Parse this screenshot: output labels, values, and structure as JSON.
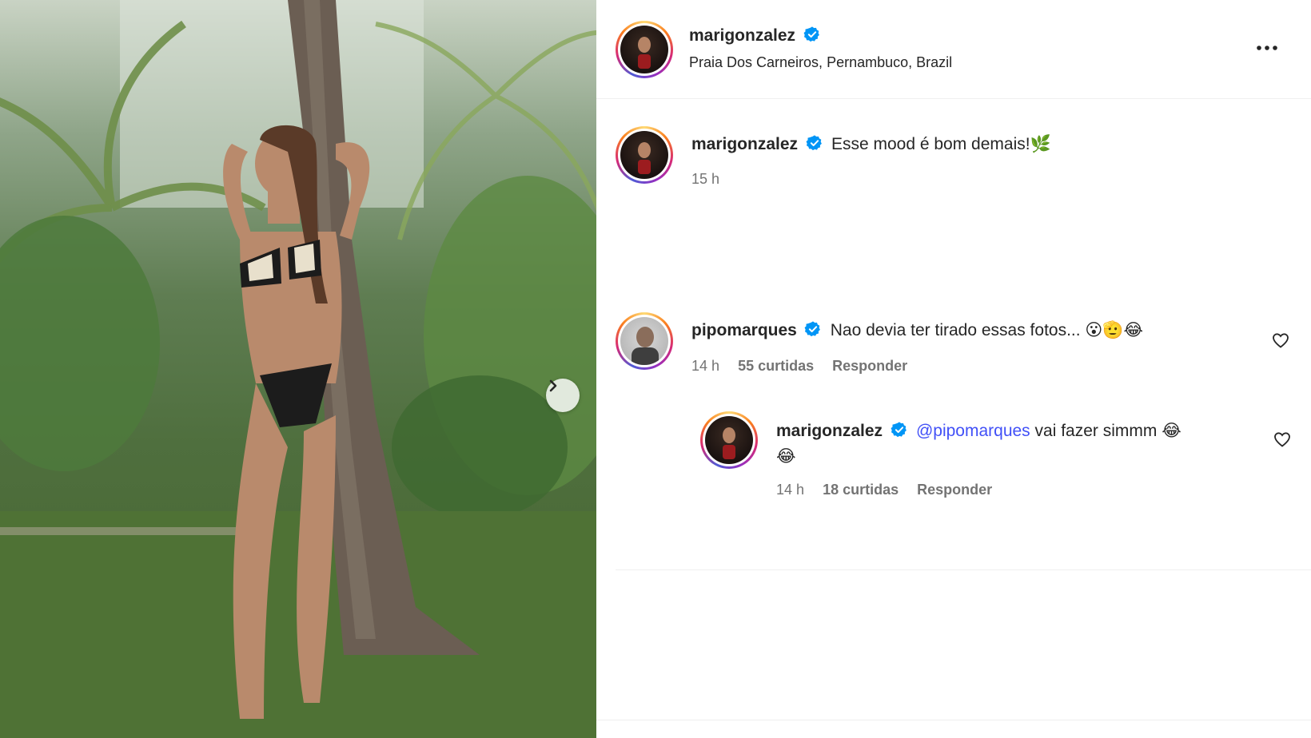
{
  "post": {
    "author": "marigonzalez",
    "location": "Praia Dos Carneiros, Pernambuco, Brazil",
    "caption": "Esse mood é bom demais!🌿",
    "caption_time": "15 h"
  },
  "comments": [
    {
      "author": "pipomarques",
      "text": "Nao devia ter tirado essas fotos... 😮🫡😂",
      "time": "14 h",
      "likes": "55 curtidas",
      "reply_label": "Responder"
    }
  ],
  "replies": [
    {
      "author": "marigonzalez",
      "mention": "@pipomarques",
      "text": " vai fazer simmm 😂",
      "text_line2": "😂",
      "time": "14 h",
      "likes": "18 curtidas",
      "reply_label": "Responder"
    }
  ],
  "colors": {
    "verified": "#0095f6",
    "mention": "#4150f7",
    "meta": "#737373"
  },
  "icons": [
    "verified-badge-icon",
    "more-options-icon",
    "heart-icon",
    "chevron-right-icon"
  ]
}
